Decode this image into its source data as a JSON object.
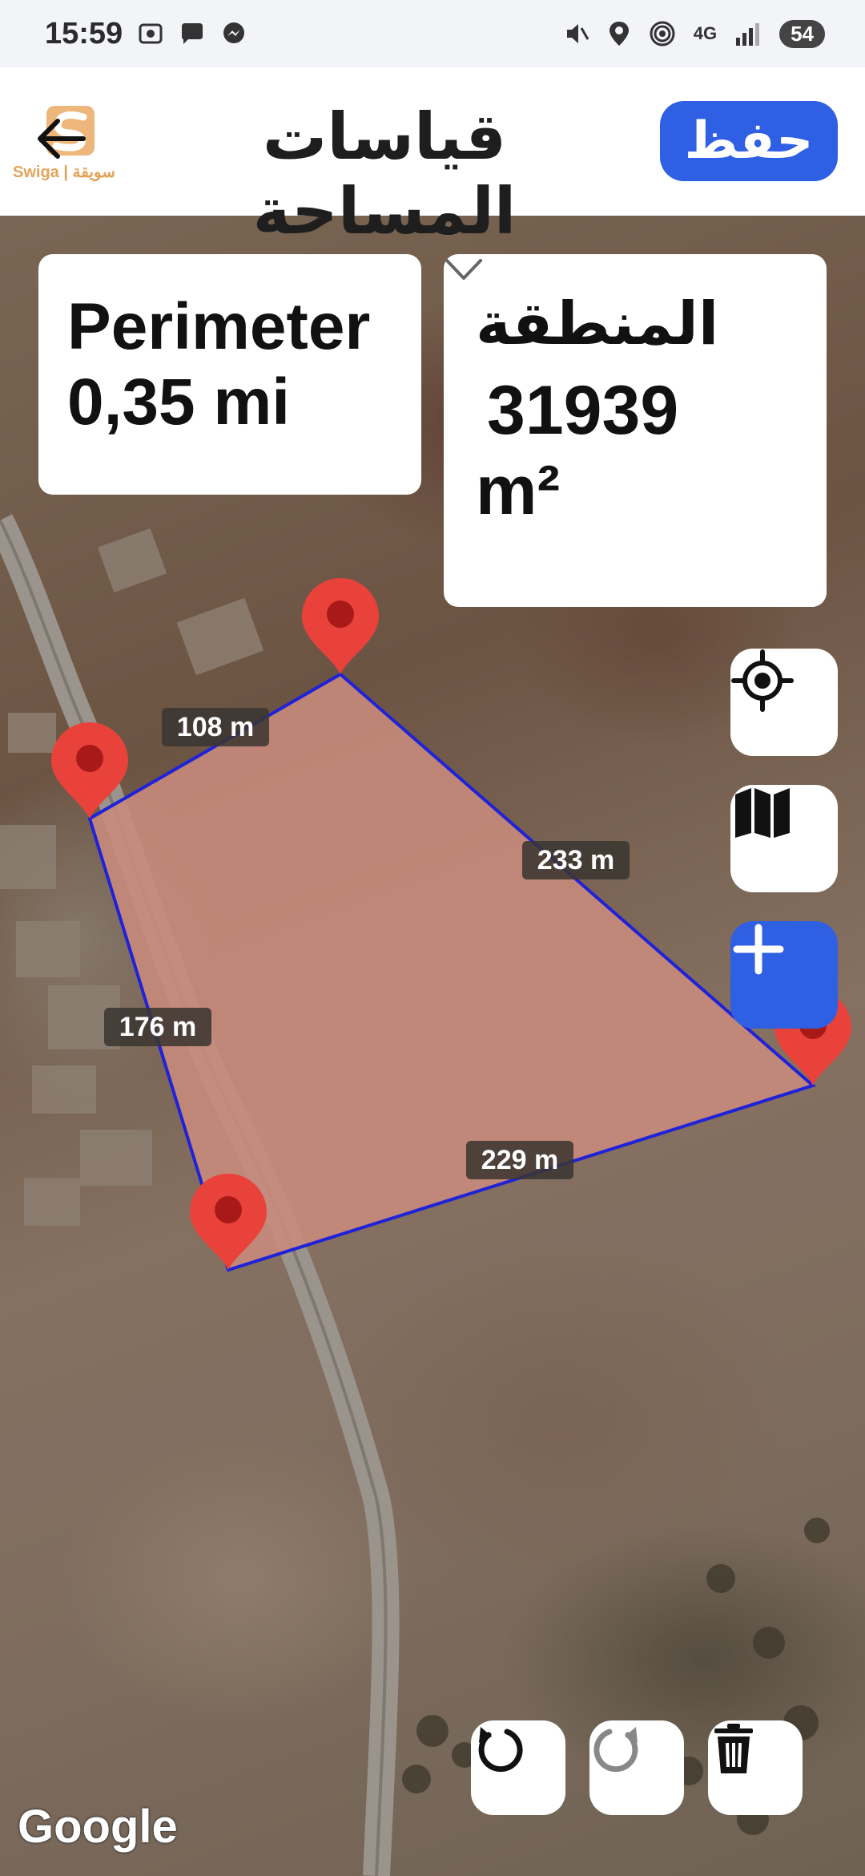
{
  "status_bar": {
    "time": "15:59",
    "network": "4G",
    "battery": "54"
  },
  "app_bar": {
    "title": "قياسات المساحة",
    "save_label": "حفظ",
    "watermark_text": "Swiga | سويقة"
  },
  "measurements": {
    "perimeter_label": "Perimeter",
    "perimeter_value": "0,35 mi",
    "area_label": "المنطقة",
    "area_value": "31939",
    "area_unit": "m²"
  },
  "edges": {
    "top_left": "108 m",
    "top_right": "233 m",
    "left": "176 m",
    "bottom": "229 m"
  },
  "map": {
    "attribution": "Google",
    "polygon_fill": "#c98b7c",
    "polygon_stroke": "#1f22d8",
    "marker_color": "#e8423b",
    "accent": "#2f5fe3"
  },
  "icons": {
    "back": "arrow-left-icon",
    "locate": "crosshair-icon",
    "layers": "map-icon",
    "add": "plus-icon",
    "undo": "undo-icon",
    "redo": "redo-icon",
    "delete": "trash-icon"
  }
}
